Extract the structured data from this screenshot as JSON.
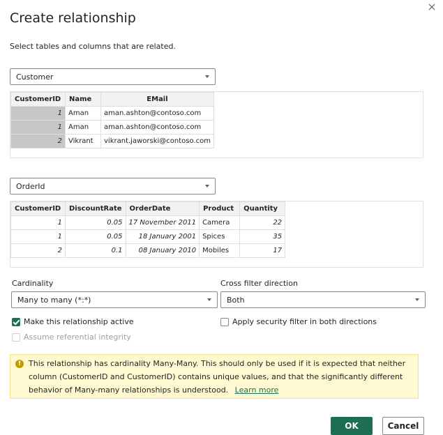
{
  "dialog": {
    "title": "Create relationship",
    "subtitle": "Select tables and columns that are related."
  },
  "table1": {
    "selected": "Customer",
    "columns": [
      "CustomerID",
      "Name",
      "EMail"
    ],
    "rows": [
      [
        "1",
        "Aman",
        "aman.ashton@contoso.com"
      ],
      [
        "1",
        "Aman",
        "aman.ashton@contoso.com"
      ],
      [
        "2",
        "Vikrant",
        "vikrant.jaworski@contoso.com"
      ]
    ]
  },
  "table2": {
    "selected": "OrderId",
    "columns": [
      "CustomerID",
      "DiscountRate",
      "OrderDate",
      "Product",
      "Quantity"
    ],
    "rows": [
      [
        "1",
        "0.05",
        "17 November 2011",
        "Camera",
        "22"
      ],
      [
        "1",
        "0.05",
        "18 January 2001",
        "Spices",
        "35"
      ],
      [
        "2",
        "0.1",
        "08 January 2010",
        "Mobiles",
        "17"
      ]
    ]
  },
  "options": {
    "cardinality_label": "Cardinality",
    "cardinality_value": "Many to many (*:*)",
    "cross_filter_label": "Cross filter direction",
    "cross_filter_value": "Both",
    "make_active_label": "Make this relationship active",
    "make_active_checked": true,
    "security_filter_label": "Apply security filter in both directions",
    "security_filter_checked": false,
    "referential_label": "Assume referential integrity",
    "referential_checked": false
  },
  "warning": {
    "text": "This relationship has cardinality Many-Many. This should only be used if it is expected that neither column (CustomerID and CustomerID) contains unique values, and that the significantly different behavior of Many-many relationships is understood.",
    "link": "Learn more"
  },
  "buttons": {
    "ok": "OK",
    "cancel": "Cancel"
  },
  "colors": {
    "accent": "#1e6e53",
    "warning_bg": "#fff9d2",
    "key_column": "#c8c6c4"
  },
  "icons": {
    "close": "close-icon",
    "warning": "warning-icon",
    "dropdown": "chevron-down-icon"
  }
}
